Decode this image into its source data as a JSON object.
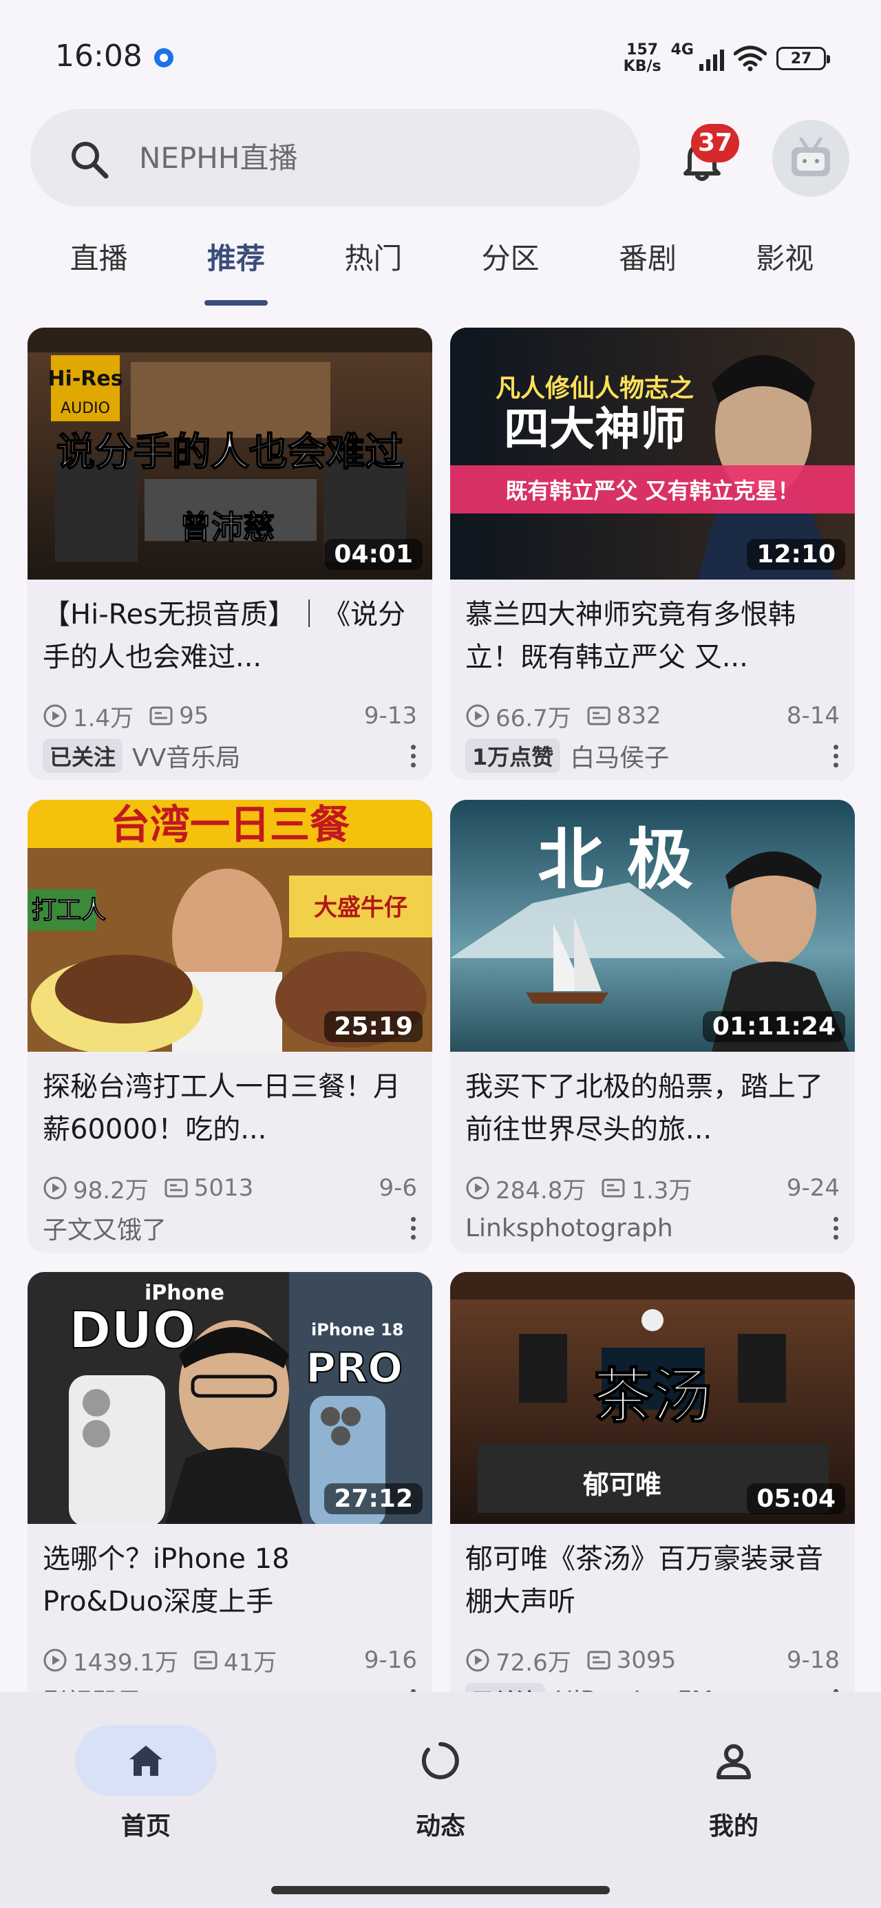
{
  "status_bar": {
    "time": "16:08",
    "net_speed_value": "157",
    "net_speed_unit": "KB/s",
    "network_type": "4G",
    "battery": "27"
  },
  "search": {
    "placeholder": "NEPHH直播"
  },
  "notifications": {
    "count": "37"
  },
  "tabs": [
    {
      "label": "直播",
      "active": false
    },
    {
      "label": "推荐",
      "active": true
    },
    {
      "label": "热门",
      "active": false
    },
    {
      "label": "分区",
      "active": false
    },
    {
      "label": "番剧",
      "active": false
    },
    {
      "label": "影视",
      "active": false
    }
  ],
  "videos": [
    {
      "duration": "04:01",
      "title": "【Hi-Res无损音质】｜《说分手的人也会难过...",
      "views": "1.4万",
      "danmaku": "95",
      "date": "9-13",
      "tag": "已关注",
      "author": "VV音乐局",
      "thumb_text": [
        "Hi-Res",
        "AUDIO",
        "说分手的人也会难过",
        "曾沛慈"
      ]
    },
    {
      "duration": "12:10",
      "title": "慕兰四大神师究竟有多恨韩立！既有韩立严父 又...",
      "views": "66.7万",
      "danmaku": "832",
      "date": "8-14",
      "tag": "1万点赞",
      "author": "白马侯子",
      "thumb_text": [
        "凡人修仙人物志之",
        "四大神师",
        "既有韩立严父 又有韩立克星！"
      ]
    },
    {
      "duration": "25:19",
      "title": "探秘台湾打工人一日三餐！月薪60000！吃的...",
      "views": "98.2万",
      "danmaku": "5013",
      "date": "9-6",
      "tag": "",
      "author": "子文又饿了",
      "thumb_text": [
        "台湾一日三餐",
        "打工人",
        "大盛牛仔"
      ]
    },
    {
      "duration": "01:11:24",
      "title": "我买下了北极的船票，踏上了前往世界尽头的旅...",
      "views": "284.8万",
      "danmaku": "1.3万",
      "date": "9-24",
      "tag": "",
      "author": "Linksphotograph",
      "thumb_text": [
        "北 极"
      ]
    },
    {
      "duration": "27:12",
      "title": "选哪个？iPhone 18 Pro&Duo深度上手",
      "views": "1439.1万",
      "danmaku": "41万",
      "date": "9-16",
      "tag": "",
      "author": "影视飓风",
      "thumb_text": [
        "iPhone",
        "DUO",
        "iPhone 18",
        "PRO"
      ]
    },
    {
      "duration": "05:04",
      "title": "郁可唯《茶汤》百万豪装录音棚大声听",
      "views": "72.6万",
      "danmaku": "3095",
      "date": "9-18",
      "tag": "已关注",
      "author": "HiRes-LeeFM",
      "thumb_text": [
        "茶汤",
        "郁可唯"
      ]
    }
  ],
  "bottom_nav": [
    {
      "label": "首页",
      "icon": "home-icon",
      "active": true
    },
    {
      "label": "动态",
      "icon": "activity-icon",
      "active": false
    },
    {
      "label": "我的",
      "icon": "profile-icon",
      "active": false
    }
  ],
  "colors": {
    "accent": "#3a4d7a",
    "badge": "#d7292a",
    "background": "#f7f5fa",
    "card": "#efedf3"
  }
}
